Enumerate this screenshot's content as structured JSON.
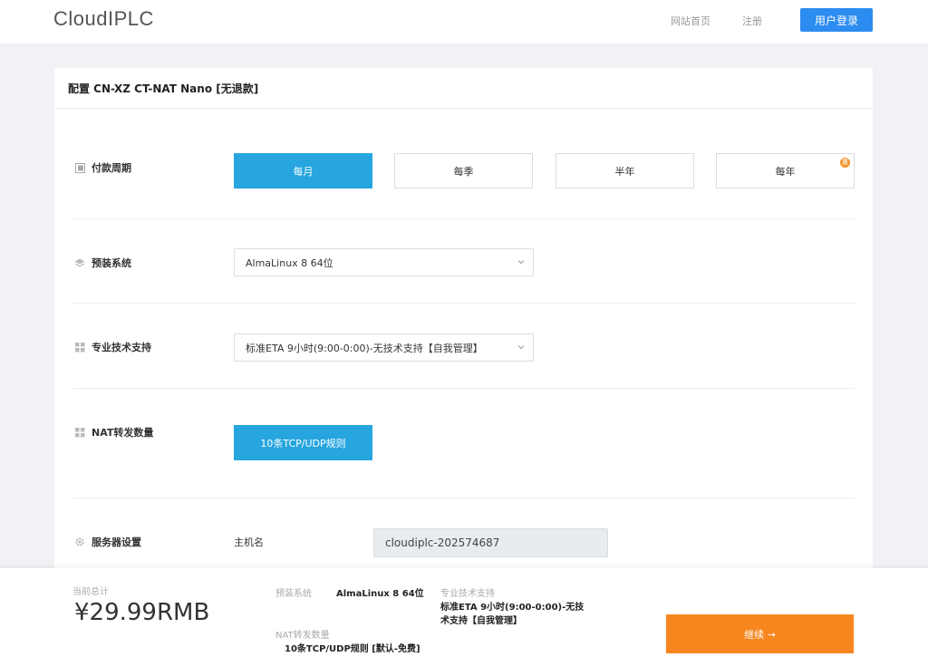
{
  "header": {
    "logo": "CloudIPLC",
    "nav_home": "网站首页",
    "nav_register": "注册",
    "login_label": "用户登录"
  },
  "config": {
    "title": "配置 CN-XZ CT-NAT Nano [无退款]",
    "billing": {
      "label": "付款周期",
      "options": [
        "每月",
        "每季",
        "半年",
        "每年"
      ],
      "selected": "每月",
      "annual_badge": "惠"
    },
    "os": {
      "label": "预装系统",
      "value": "AlmaLinux 8 64位"
    },
    "support": {
      "label": "专业技术支持",
      "value": "标准ETA 9小时(9:00-0:00)-无技术支持【自我管理】"
    },
    "nat": {
      "label": "NAT转发数量",
      "value": "10条TCP/UDP规则"
    },
    "server": {
      "label": "服务器设置",
      "hostname_label": "主机名",
      "hostname_value": "cloudiplc-202574687"
    }
  },
  "summary": {
    "total_label": "当前总计",
    "total_price": "¥29.99RMB",
    "os_label": "预装系统",
    "os_value": "AlmaLinux 8 64位",
    "support_label": "专业技术支持",
    "support_value_line1": "标准ETA 9小时(9:00-0:00)-无技",
    "support_value_line2": "术支持【自我管理】",
    "nat_label": "NAT转发数量",
    "nat_value": "10条TCP/UDP规则 [默认-免费]",
    "continue_label": "继续 →"
  },
  "colors": {
    "primary_blue": "#26a5de",
    "login_blue": "#2d8cf0",
    "continue_orange": "#f7861e",
    "badge_orange": "#f0932b",
    "background": "#f0f2f5"
  },
  "icons": {
    "billing": "calendar-icon",
    "os": "layers-icon",
    "support": "grid-icon",
    "nat": "grid-icon",
    "server": "gear-icon",
    "select_caret": "chevron-down-icon"
  }
}
